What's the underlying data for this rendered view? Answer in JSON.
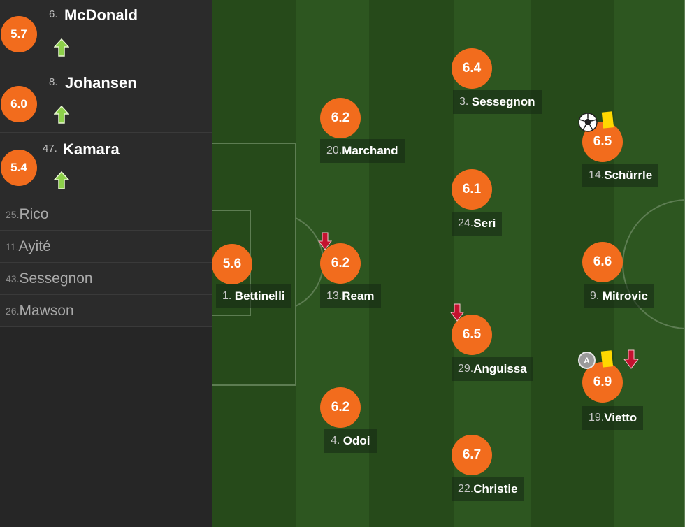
{
  "colors": {
    "rating_bg": "#f26c1d",
    "sub_in_arrow": "#8dd04a",
    "sub_out_arrow": "#c4122f",
    "yellow_card": "#ffd800",
    "pitch_dark": "#264a1a",
    "pitch_light": "#2e5a20"
  },
  "substitutes": [
    {
      "rating": "5.7",
      "number": "6.",
      "name": "McDonald",
      "icon": "sub-in-arrow-icon"
    },
    {
      "rating": "6.0",
      "number": "8.",
      "name": "Johansen",
      "icon": "sub-in-arrow-icon"
    },
    {
      "rating": "5.4",
      "number": "47.",
      "name": "Kamara",
      "icon": "sub-in-arrow-icon"
    }
  ],
  "bench": [
    {
      "number": "25.",
      "name": "Rico"
    },
    {
      "number": "11.",
      "name": "Ayité"
    },
    {
      "number": "43.",
      "name": "Sessegnon"
    },
    {
      "number": "26.",
      "name": "Mawson"
    }
  ],
  "players": {
    "bettinelli": {
      "rating": "5.6",
      "number": "1.",
      "name": "Bettinelli"
    },
    "marchand": {
      "rating": "6.2",
      "number": "20.",
      "name": "Marchand"
    },
    "ream": {
      "rating": "6.2",
      "number": "13.",
      "name": "Ream",
      "events": [
        "sub-out-arrow-icon"
      ]
    },
    "odoi": {
      "rating": "6.2",
      "number": "4.",
      "name": "Odoi"
    },
    "sessegnon": {
      "rating": "6.4",
      "number": "3.",
      "name": "Sessegnon"
    },
    "seri": {
      "rating": "6.1",
      "number": "24.",
      "name": "Seri"
    },
    "anguissa": {
      "rating": "6.5",
      "number": "29.",
      "name": "Anguissa",
      "events": [
        "sub-out-arrow-icon"
      ]
    },
    "christie": {
      "rating": "6.7",
      "number": "22.",
      "name": "Christie"
    },
    "schurrle": {
      "rating": "6.5",
      "number": "14.",
      "name": "Schürrle",
      "events": [
        "goal-ball-icon",
        "yellow-card-icon"
      ]
    },
    "mitrovic": {
      "rating": "6.6",
      "number": "9.",
      "name": "Mitrovic"
    },
    "vietto": {
      "rating": "6.9",
      "number": "19.",
      "name": "Vietto",
      "events": [
        "assist-icon",
        "yellow-card-icon",
        "sub-out-arrow-icon"
      ],
      "assist_letter": "A"
    }
  }
}
